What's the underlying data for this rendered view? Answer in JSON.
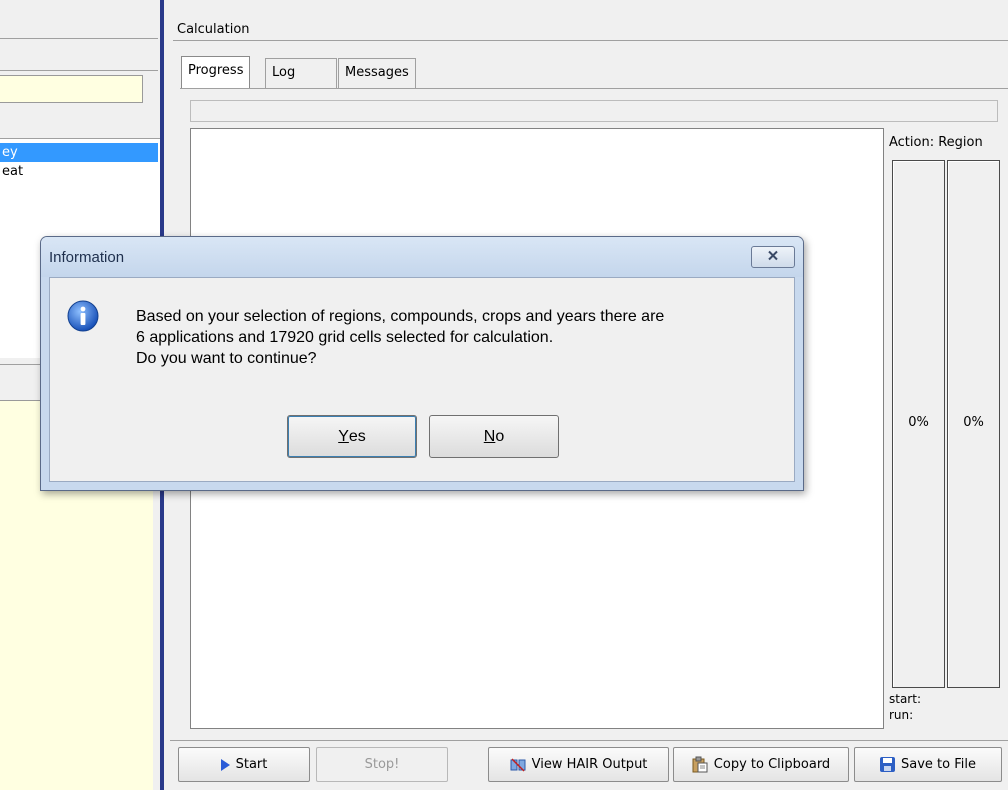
{
  "left_panel": {
    "list_items": [
      "ey",
      "eat"
    ],
    "selected_index": 0
  },
  "calculation": {
    "title": "Calculation",
    "tabs": [
      {
        "label": "Progress",
        "active": true
      },
      {
        "label": "Log",
        "active": false
      },
      {
        "label": "Messages",
        "active": false
      }
    ],
    "progress_fraction": 0,
    "side_labels": {
      "action": "Action:",
      "region": "Region",
      "start": "start:",
      "run": "run:"
    },
    "gauges": [
      {
        "name": "action",
        "value": "0%",
        "fraction": 0
      },
      {
        "name": "region",
        "value": "0%",
        "fraction": 0
      }
    ]
  },
  "toolbar": {
    "start_label": "Start",
    "stop_label": "Stop!",
    "view_hair_label": "View HAIR Output",
    "copy_label": "Copy to Clipboard",
    "save_label": "Save to File",
    "stop_disabled": true
  },
  "dialog": {
    "title": "Information",
    "message_lines": [
      "Based on your selection of regions, compounds, crops and years there are",
      "6 applications and 17920 grid cells selected for calculation.",
      "Do you want to continue?"
    ],
    "yes_accel": "Y",
    "yes_rest": "es",
    "no_accel": "N",
    "no_rest": "o"
  },
  "colors": {
    "selection": "#3399ff",
    "splitter": "#2a3a8a",
    "info_panel_yellow": "#ffffe1",
    "dialog_frame": "#c8d9ee"
  },
  "icons": [
    "close-icon",
    "info-icon",
    "play-icon",
    "hair-output-icon",
    "clipboard-icon",
    "floppy-disk-icon"
  ]
}
